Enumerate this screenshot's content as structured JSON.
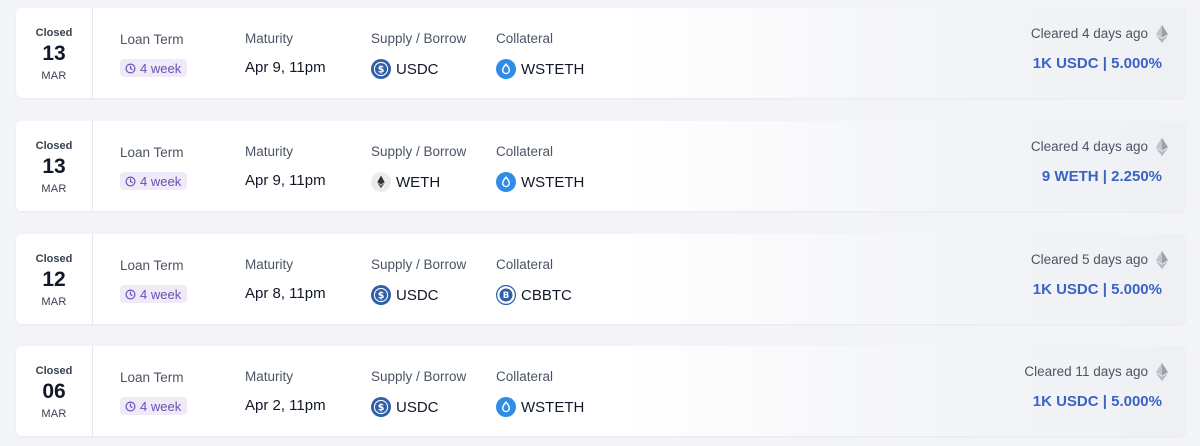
{
  "colors": {
    "accent": "#3b63c4",
    "badge_bg": "#eeeaf7",
    "badge_text": "#6b4fb3"
  },
  "labels": {
    "loan_term": "Loan Term",
    "maturity": "Maturity",
    "supply_borrow": "Supply / Borrow",
    "collateral": "Collateral"
  },
  "auctions": [
    {
      "status": "Closed",
      "day": "13",
      "month": "MAR",
      "term": "4 week",
      "maturity": "Apr 9, 11pm",
      "supply": {
        "symbol": "USDC",
        "icon": "usdc-icon"
      },
      "collateral": {
        "symbol": "WSTETH",
        "icon": "wsteth-icon"
      },
      "cleared": "Cleared 4 days ago",
      "chain_icon": "ethereum-icon",
      "offer": "1K USDC | 5.000%"
    },
    {
      "status": "Closed",
      "day": "13",
      "month": "MAR",
      "term": "4 week",
      "maturity": "Apr 9, 11pm",
      "supply": {
        "symbol": "WETH",
        "icon": "weth-icon"
      },
      "collateral": {
        "symbol": "WSTETH",
        "icon": "wsteth-icon"
      },
      "cleared": "Cleared 4 days ago",
      "chain_icon": "ethereum-icon",
      "offer": "9 WETH | 2.250%"
    },
    {
      "status": "Closed",
      "day": "12",
      "month": "MAR",
      "term": "4 week",
      "maturity": "Apr 8, 11pm",
      "supply": {
        "symbol": "USDC",
        "icon": "usdc-icon"
      },
      "collateral": {
        "symbol": "CBBTC",
        "icon": "cbbtc-icon"
      },
      "cleared": "Cleared 5 days ago",
      "chain_icon": "ethereum-icon",
      "offer": "1K USDC | 5.000%"
    },
    {
      "status": "Closed",
      "day": "06",
      "month": "MAR",
      "term": "4 week",
      "maturity": "Apr 2, 11pm",
      "supply": {
        "symbol": "USDC",
        "icon": "usdc-icon"
      },
      "collateral": {
        "symbol": "WSTETH",
        "icon": "wsteth-icon"
      },
      "cleared": "Cleared 11 days ago",
      "chain_icon": "ethereum-icon",
      "offer": "1K USDC | 5.000%"
    }
  ]
}
